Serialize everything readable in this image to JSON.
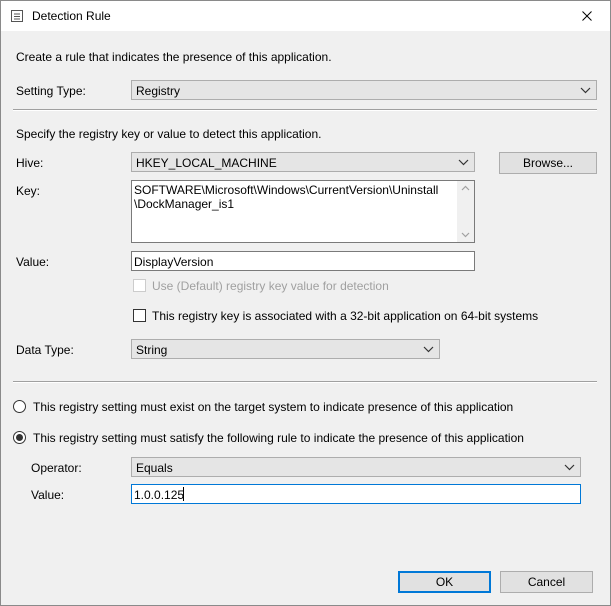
{
  "window": {
    "title": "Detection Rule",
    "close_glyph": "✕"
  },
  "intro": "Create a rule that indicates the presence of this application.",
  "setting_type": {
    "label": "Setting Type:",
    "value": "Registry"
  },
  "registry": {
    "instructions": "Specify the registry key or value to detect this application.",
    "hive_label": "Hive:",
    "hive_value": "HKEY_LOCAL_MACHINE",
    "browse_label": "Browse...",
    "key_label": "Key:",
    "key_value": "SOFTWARE\\Microsoft\\Windows\\CurrentVersion\\Uninstall\n\\DockManager_is1",
    "value_label": "Value:",
    "value_value": "DisplayVersion",
    "use_default_label": "Use (Default) registry key value for detection",
    "use_default_checked": false,
    "use_default_enabled": false,
    "bit32_label": "This registry key is associated with a 32-bit application on 64-bit systems",
    "bit32_checked": false,
    "data_type_label": "Data Type:",
    "data_type_value": "String"
  },
  "rules": {
    "exist_label": "This registry setting must exist on the target system to indicate presence of this application",
    "exist_selected": false,
    "satisfy_label": "This registry setting must satisfy the following rule to indicate the presence of this application",
    "satisfy_selected": true,
    "operator_label": "Operator:",
    "operator_value": "Equals",
    "value_label": "Value:",
    "value_value": "1.0.0.125"
  },
  "buttons": {
    "ok_label": "OK",
    "cancel_label": "Cancel"
  },
  "colors": {
    "accent": "#0078d7",
    "window_bg": "#f0f0f0"
  }
}
